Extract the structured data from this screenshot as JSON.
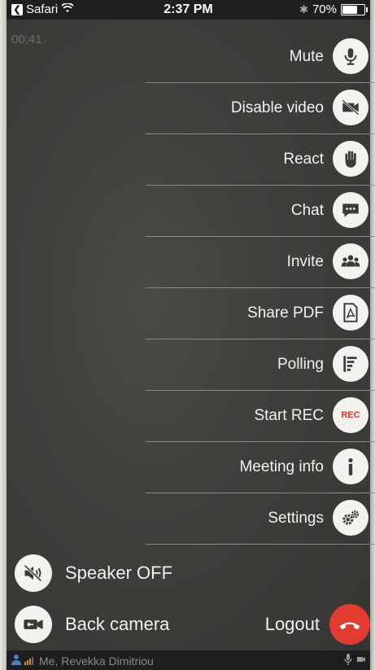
{
  "status_bar": {
    "carrier": "Safari",
    "time": "2:37 PM",
    "battery": "70%",
    "battery_level": 0.7
  },
  "call_timer": "00:41",
  "menu": {
    "items": [
      {
        "label": "Mute",
        "icon": "microphone-icon"
      },
      {
        "label": "Disable video",
        "icon": "video-off-icon"
      },
      {
        "label": "React",
        "icon": "hand-icon"
      },
      {
        "label": "Chat",
        "icon": "chat-icon"
      },
      {
        "label": "Invite",
        "icon": "group-icon"
      },
      {
        "label": "Share PDF",
        "icon": "pdf-icon"
      },
      {
        "label": "Polling",
        "icon": "polling-icon"
      },
      {
        "label": "Start REC",
        "icon": "rec-icon",
        "badge": "REC"
      },
      {
        "label": "Meeting info",
        "icon": "info-icon"
      },
      {
        "label": "Settings",
        "icon": "gears-icon"
      }
    ]
  },
  "controls": {
    "speaker_label": "Speaker OFF",
    "camera_label": "Back camera",
    "logout_label": "Logout"
  },
  "footer": {
    "participant": "Me, Revekka Dimitriou"
  },
  "colors": {
    "accent_red": "#e23b2f",
    "button_bg": "#f2f2ef",
    "overlay_bg": "#3f3f3c"
  }
}
